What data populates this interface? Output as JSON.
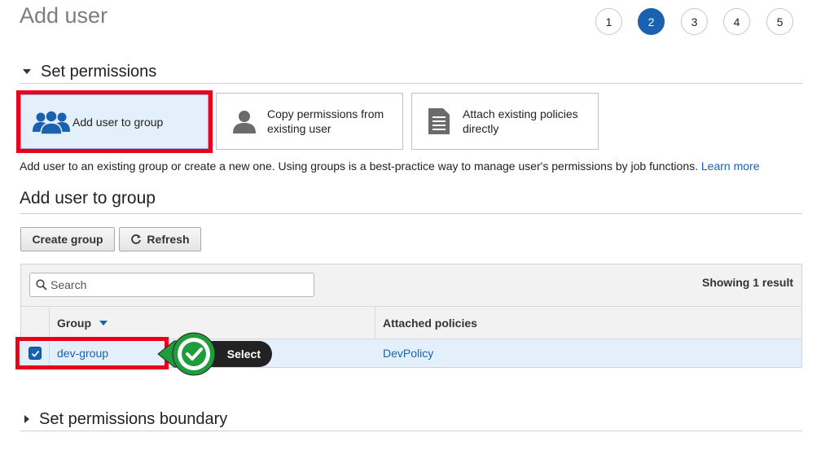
{
  "page": {
    "title": "Add user"
  },
  "steps": [
    "1",
    "2",
    "3",
    "4",
    "5"
  ],
  "active_step": "2",
  "permissions": {
    "heading": "Set permissions",
    "options": [
      {
        "label": "Add user to group",
        "icon": "users-group-icon",
        "selected": true
      },
      {
        "label": "Copy permissions from existing user",
        "icon": "user-icon",
        "selected": false
      },
      {
        "label": "Attach existing policies directly",
        "icon": "document-icon",
        "selected": false
      }
    ],
    "description": "Add user to an existing group or create a new one. Using groups is a best-practice way to manage user's permissions by job functions.",
    "learn_more": "Learn more"
  },
  "group_section": {
    "heading": "Add user to group",
    "create_button": "Create group",
    "refresh_button": "Refresh",
    "search_placeholder": "Search",
    "result_count": "Showing 1 result",
    "columns": [
      "Group",
      "Attached policies"
    ],
    "rows": [
      {
        "group": "dev-group",
        "policies": "DevPolicy",
        "checked": true
      }
    ]
  },
  "callout": {
    "label": "Select"
  },
  "boundary": {
    "heading": "Set permissions boundary"
  },
  "colors": {
    "accent": "#1a62b0",
    "highlight": "#e8001d",
    "check_green": "#1f9d3a",
    "selected_bg": "#e3f0fb"
  }
}
